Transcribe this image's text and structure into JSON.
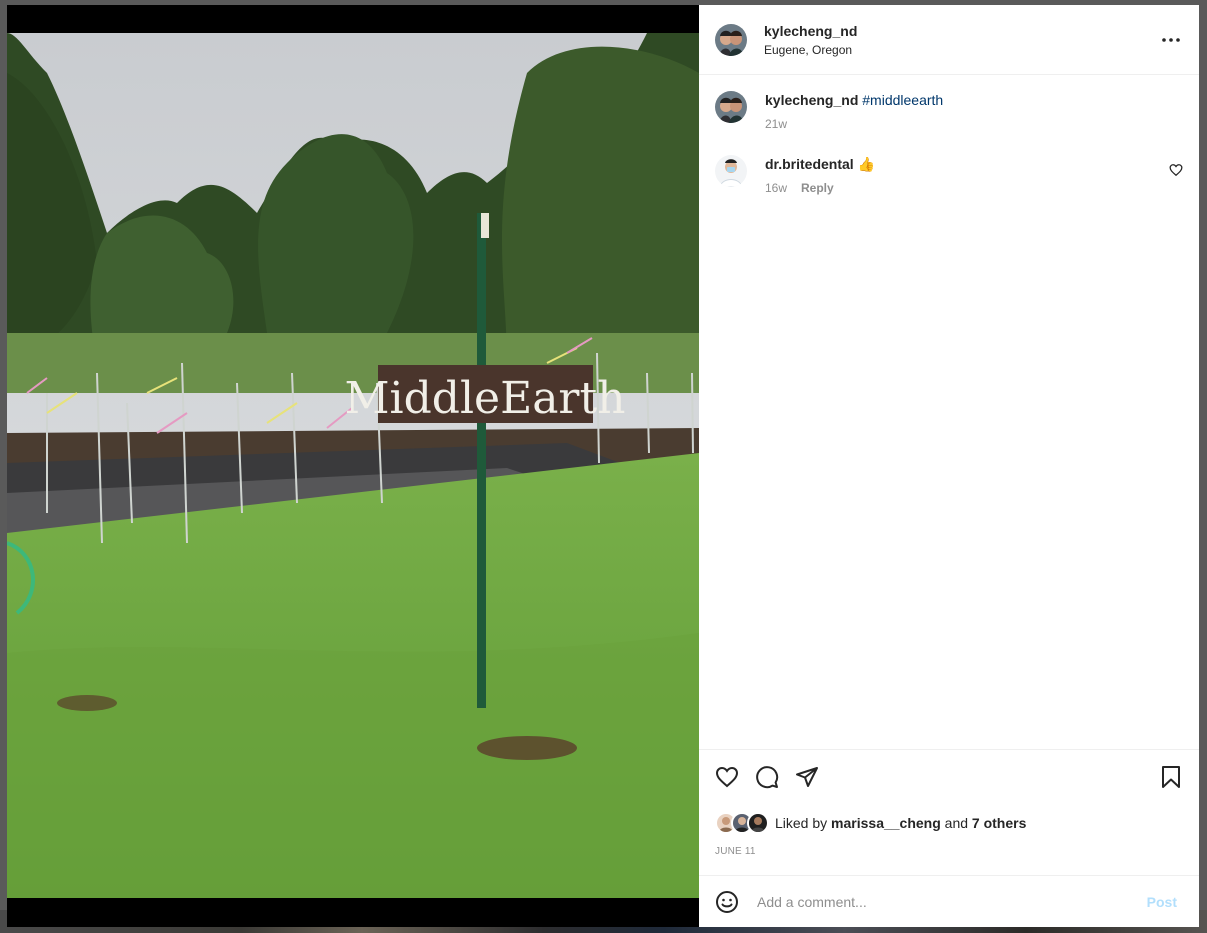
{
  "post": {
    "author": "kylecheng_nd",
    "location": "Eugene, Oregon",
    "sign_text": "MiddleEarth"
  },
  "comments": [
    {
      "username": "kylecheng_nd",
      "text": "#middleearth",
      "time": "21w",
      "is_caption": true
    },
    {
      "username": "dr.britedental",
      "text": "👍",
      "time": "16w",
      "reply_label": "Reply"
    }
  ],
  "likes": {
    "prefix": "Liked by",
    "user": "marissa__cheng",
    "joiner": "and",
    "others": "7 others"
  },
  "date": "JUNE 11",
  "composer": {
    "placeholder": "Add a comment...",
    "post_label": "Post"
  },
  "icons": {
    "more": "more-options-icon",
    "like": "heart-icon",
    "comment": "comment-icon",
    "share": "share-icon",
    "save": "bookmark-icon",
    "emoji": "emoji-icon"
  },
  "colors": {
    "hashtag": "#00376b",
    "post_button": "#b2dffc",
    "muted": "#8e8e8e"
  }
}
